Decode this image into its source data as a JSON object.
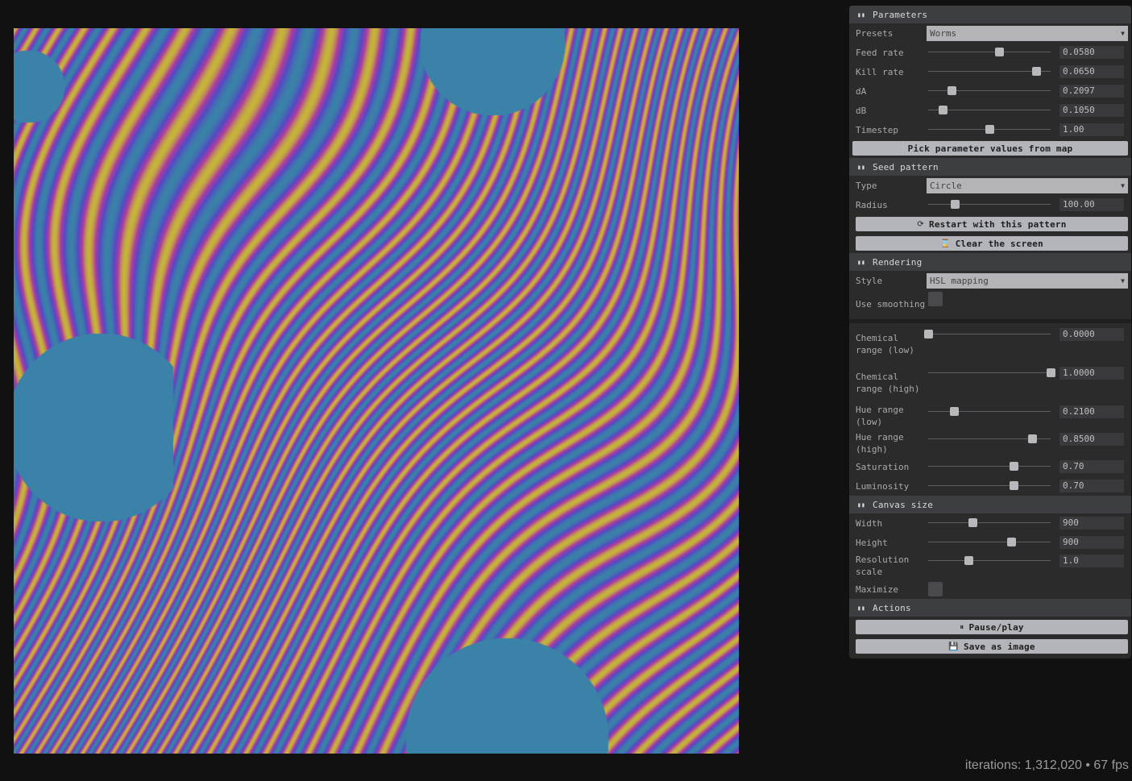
{
  "colors": {
    "background": "#111111",
    "panel": "#2b2b2c",
    "panel_header": "#3d3e41",
    "button": "#b4b5ba",
    "pattern_primary": "#3a82a8",
    "pattern_blue": "#5548c6",
    "pattern_magenta": "#b03c9e",
    "pattern_yellow": "#c6b43a"
  },
  "status": {
    "text": "iterations: 1,312,020 • 67 fps"
  },
  "parameters": {
    "title": "Parameters",
    "presets_label": "Presets",
    "presets_value": "Worms",
    "feed_label": "Feed rate",
    "feed_value": "0.0580",
    "feed_fraction": 0.58,
    "kill_label": "Kill rate",
    "kill_value": "0.0650",
    "kill_fraction": 0.88,
    "da_label": "dA",
    "da_value": "0.2097",
    "da_fraction": 0.19,
    "db_label": "dB",
    "db_value": "0.1050",
    "db_fraction": 0.12,
    "timestep_label": "Timestep",
    "timestep_value": "1.00",
    "timestep_fraction": 0.5,
    "pick_button": "Pick parameter values from map"
  },
  "seed": {
    "title": "Seed pattern",
    "type_label": "Type",
    "type_value": "Circle",
    "radius_label": "Radius",
    "radius_value": "100.00",
    "radius_fraction": 0.22,
    "restart_icon": "refresh-icon",
    "restart_button": "Restart with this pattern",
    "clear_icon": "hourglass-icon",
    "clear_button": "Clear the screen"
  },
  "rendering": {
    "title": "Rendering",
    "style_label": "Style",
    "style_value": "HSL mapping",
    "smoothing_label": "Use smoothing",
    "chem_low_label": "Chemical range (low)",
    "chem_low_value": "0.0000",
    "chem_low_fraction": 0.0,
    "chem_high_label": "Chemical range (high)",
    "chem_high_value": "1.0000",
    "chem_high_fraction": 1.0,
    "hue_low_label": "Hue range (low)",
    "hue_low_value": "0.2100",
    "hue_low_fraction": 0.21,
    "hue_high_label": "Hue range (high)",
    "hue_high_value": "0.8500",
    "hue_high_fraction": 0.85,
    "saturation_label": "Saturation",
    "saturation_value": "0.70",
    "saturation_fraction": 0.7,
    "luminosity_label": "Luminosity",
    "luminosity_value": "0.70",
    "luminosity_fraction": 0.7
  },
  "canvas_size": {
    "title": "Canvas size",
    "width_label": "Width",
    "width_value": "900",
    "width_fraction": 0.36,
    "height_label": "Height",
    "height_value": "900",
    "height_fraction": 0.68,
    "res_label": "Resolution scale",
    "res_value": "1.0",
    "res_fraction": 0.33,
    "maximize_label": "Maximize"
  },
  "actions": {
    "title": "Actions",
    "pause_icon": "pause-icon",
    "pause_button": "Pause/play",
    "save_icon": "floppy-disk-icon",
    "save_button": "Save as image"
  }
}
